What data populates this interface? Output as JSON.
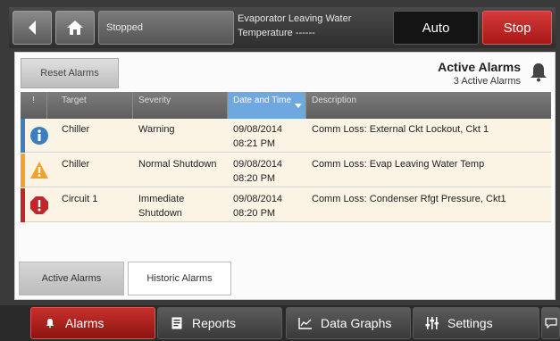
{
  "topbar": {
    "status": "Stopped",
    "evap_line1": "Evaporator Leaving Water",
    "evap_line2": "Temperature ------",
    "auto_label": "Auto",
    "stop_label": "Stop"
  },
  "panel": {
    "reset_label": "Reset Alarms",
    "title": "Active Alarms",
    "count": "3 Active Alarms"
  },
  "table": {
    "headers": {
      "indicator": "!",
      "target": "Target",
      "severity": "Severity",
      "date_time": "Date and Time",
      "description": "Description"
    },
    "rows": [
      {
        "icon": "info-icon",
        "color": "#3b7fc0",
        "target": "Chiller",
        "severity": "Warning",
        "date": "09/08/2014",
        "time": "08:21 PM",
        "description": "Comm Loss: External Ckt Lockout, Ckt 1"
      },
      {
        "icon": "warning-icon",
        "color": "#f2a22a",
        "target": "Chiller",
        "severity": "Normal Shutdown",
        "date": "09/08/2014",
        "time": "08:20 PM",
        "description": "Comm Loss: Evap Leaving Water Temp"
      },
      {
        "icon": "stop-icon",
        "color": "#c0272d",
        "target": "Circuit 1",
        "severity": "Immediate Shutdown",
        "date": "09/08/2014",
        "time": "08:20 PM",
        "description": "Comm Loss: Condenser Rfgt Pressure, Ckt1"
      }
    ]
  },
  "tabs": {
    "active": "Active Alarms",
    "historic": "Historic Alarms"
  },
  "nav": {
    "alarms": "Alarms",
    "reports": "Reports",
    "graphs": "Data Graphs",
    "settings": "Settings"
  },
  "colors": {
    "accent_red": "#c0272d",
    "header_blue": "#6fa8e0",
    "row_bg": "#fbf3e4"
  }
}
